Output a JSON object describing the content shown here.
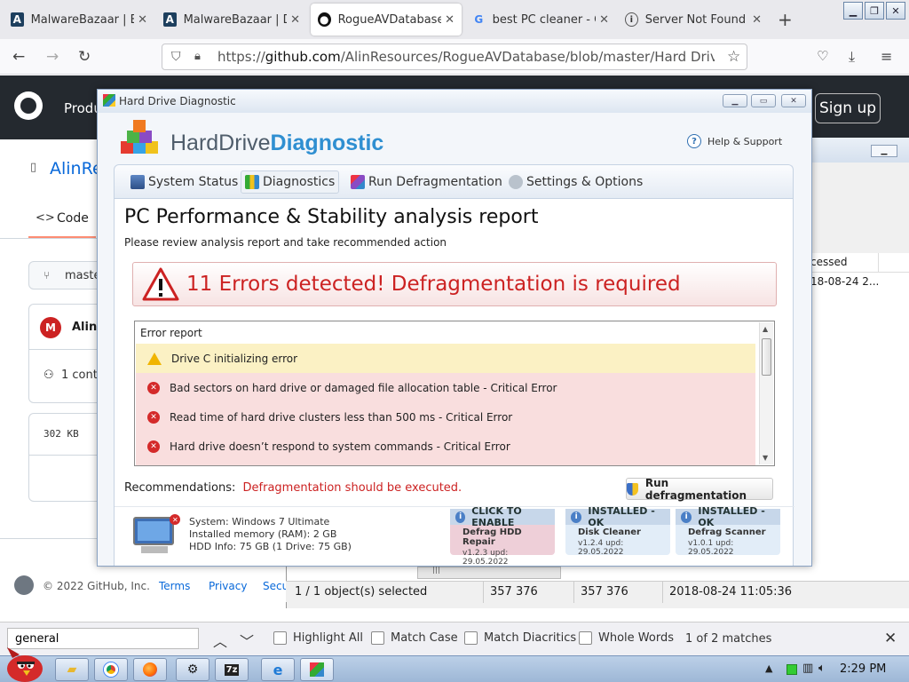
{
  "browser": {
    "tabs": [
      {
        "title": "MalwareBazaar | Bro",
        "icon": "malwarebazaar-icon"
      },
      {
        "title": "MalwareBazaar | Do",
        "icon": "malwarebazaar-icon"
      },
      {
        "title": "RogueAVDatabase/H",
        "icon": "github-icon",
        "active": true
      },
      {
        "title": "best PC cleaner - Go",
        "icon": "google-icon"
      },
      {
        "title": "Server Not Found",
        "icon": "info-icon"
      }
    ],
    "url_prefix": "https://",
    "url_host": "github.com",
    "url_path": "/AlinResources/RogueAVDatabase/blob/master/Hard Drive Diagno"
  },
  "github": {
    "product": "Produ",
    "signup": "Sign up",
    "repo": "AlinRe",
    "code_tab": "Code",
    "branch": "maste",
    "user": "Alin",
    "contributors": "1 cont",
    "size": "302 KB",
    "footer_copyright": "© 2022 GitHub, Inc.",
    "footer_links": [
      "Terms",
      "Privacy",
      "Secu"
    ]
  },
  "bgwindow": {
    "col_header": "cessed",
    "cell": "18-08-24 2...",
    "status": {
      "selected": "1 / 1 object(s) selected",
      "size1": "357 376",
      "size2": "357 376",
      "date": "2018-08-24 11:05:36"
    }
  },
  "findbar": {
    "query": "general",
    "options": [
      "Highlight All",
      "Match Case",
      "Match Diacritics",
      "Whole Words"
    ],
    "matches": "1 of 2 matches"
  },
  "taskbar": {
    "time": "2:29 PM"
  },
  "app": {
    "window_title": "Hard Drive Diagnostic",
    "brand_part1": "HardDrive",
    "brand_part2": "Diagnostic",
    "help": "Help & Support",
    "tabs": [
      "System Status",
      "Diagnostics",
      "Run Defragmentation",
      "Settings & Options"
    ],
    "selected_tab": "Diagnostics",
    "report_title": "PC Performance & Stability analysis report",
    "report_subtitle": "Please review analysis report and take recommended action",
    "alert": "11 Errors detected! Defragmentation is required",
    "error_report_label": "Error report",
    "errors": [
      {
        "text": "Drive C initializing error",
        "level": "warning"
      },
      {
        "text": "Bad sectors on hard drive or damaged file allocation table - Critical Error",
        "level": "critical"
      },
      {
        "text": "Read time of hard drive clusters less than 500 ms - Critical Error",
        "level": "critical"
      },
      {
        "text": "Hard drive doesn’t respond to system commands - Critical Error",
        "level": "critical"
      }
    ],
    "recommendations_label": "Recommendations:",
    "recommendations_value": "Defragmentation should be executed.",
    "run_button": "Run defragmentation",
    "system": {
      "os": "System: Windows 7 Ultimate",
      "ram": "Installed memory (RAM): 2 GB",
      "hdd": "HDD Info: 75 GB (1 Drive: 75 GB)"
    },
    "cards": [
      {
        "header": "CLICK TO ENABLE",
        "name": "Defrag HDD Repair",
        "version": "v1.2.3 upd: 29.05.2022"
      },
      {
        "header": "INSTALLED - OK",
        "name": "Disk Cleaner",
        "version": "v1.2.4 upd: 29.05.2022"
      },
      {
        "header": "INSTALLED - OK",
        "name": "Defrag Scanner",
        "version": "v1.0.1 upd: 29.05.2022"
      }
    ]
  }
}
